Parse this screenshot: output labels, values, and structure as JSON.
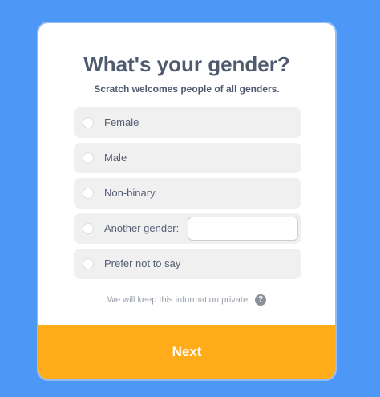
{
  "dialog": {
    "title": "What's your gender?",
    "subtitle": "Scratch welcomes people of all genders."
  },
  "options": [
    {
      "label": "Female"
    },
    {
      "label": "Male"
    },
    {
      "label": "Non-binary"
    },
    {
      "label": "Another gender:",
      "input_value": ""
    },
    {
      "label": "Prefer not to say"
    }
  ],
  "privacy": {
    "text": "We will keep this information private.",
    "help_icon": "question-circle-icon",
    "help_glyph": "?"
  },
  "next_button": {
    "label": "Next"
  },
  "colors": {
    "background": "#4d97f6",
    "accent": "#ffab1a",
    "text": "#4f5a6e"
  }
}
